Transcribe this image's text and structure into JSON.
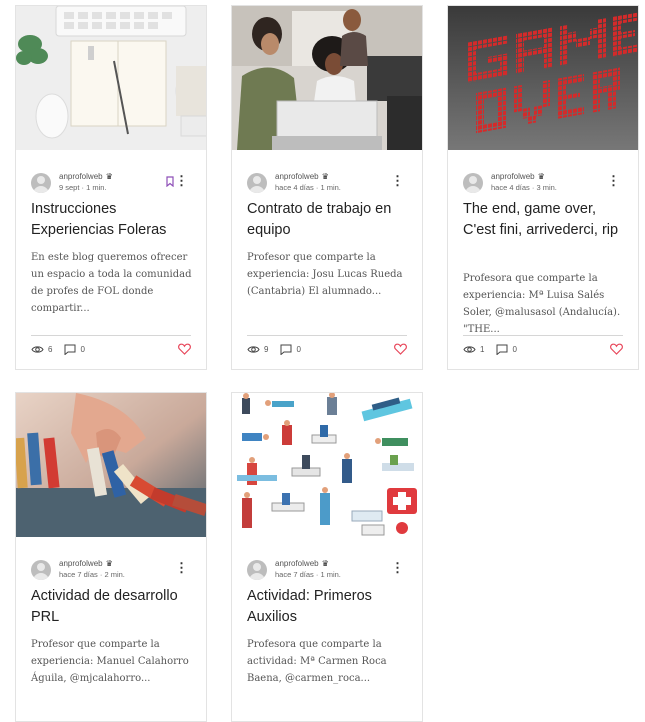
{
  "colors": {
    "accent": "#e8475b",
    "bookmark": "#8e4fb8"
  },
  "posts": [
    {
      "author": "anprofolweb",
      "date": "9 sept",
      "read_time": "1 min.",
      "title": "Instrucciones Experiencias Foleras",
      "excerpt": "En este blog queremos ofrecer un espacio a toda la comunidad de profes de FOL donde compartir...",
      "views": "6",
      "comments": "0",
      "image": "desk-notebook-photo"
    },
    {
      "author": "anprofolweb",
      "date": "hace 4 días",
      "read_time": "1 min.",
      "title": "Contrato de trabajo en equipo",
      "excerpt": "Profesor que comparte la experiencia: Josu Lucas Rueda (Cantabria) El alumnado...",
      "views": "9",
      "comments": "0",
      "image": "team-at-laptop-photo"
    },
    {
      "author": "anprofolweb",
      "date": "hace 4 días",
      "read_time": "3 min.",
      "title": "The end, game over, C'est fini, arrivederci, rip",
      "excerpt": "Profesora que comparte la experiencia: Mª Luisa Salés Soler, @malusasol (Andalucía). \"THE...",
      "views": "1",
      "comments": "0",
      "image": "game-over-pixel-photo"
    },
    {
      "author": "anprofolweb",
      "date": "hace 7 días",
      "read_time": "2 min.",
      "title": "Actividad de desarrollo PRL",
      "excerpt": "Profesor que comparte la experiencia: Manuel Calahorro Águila, @mjcalahorro...",
      "image": "domino-hand-photo"
    },
    {
      "author": "anprofolweb",
      "date": "hace 7 días",
      "read_time": "1 min.",
      "title": "Actividad: Primeros Auxilios",
      "excerpt": "Profesora que comparte la actividad: Mª Carmen Roca Baena, @carmen_roca...",
      "image": "first-aid-illustration"
    }
  ]
}
